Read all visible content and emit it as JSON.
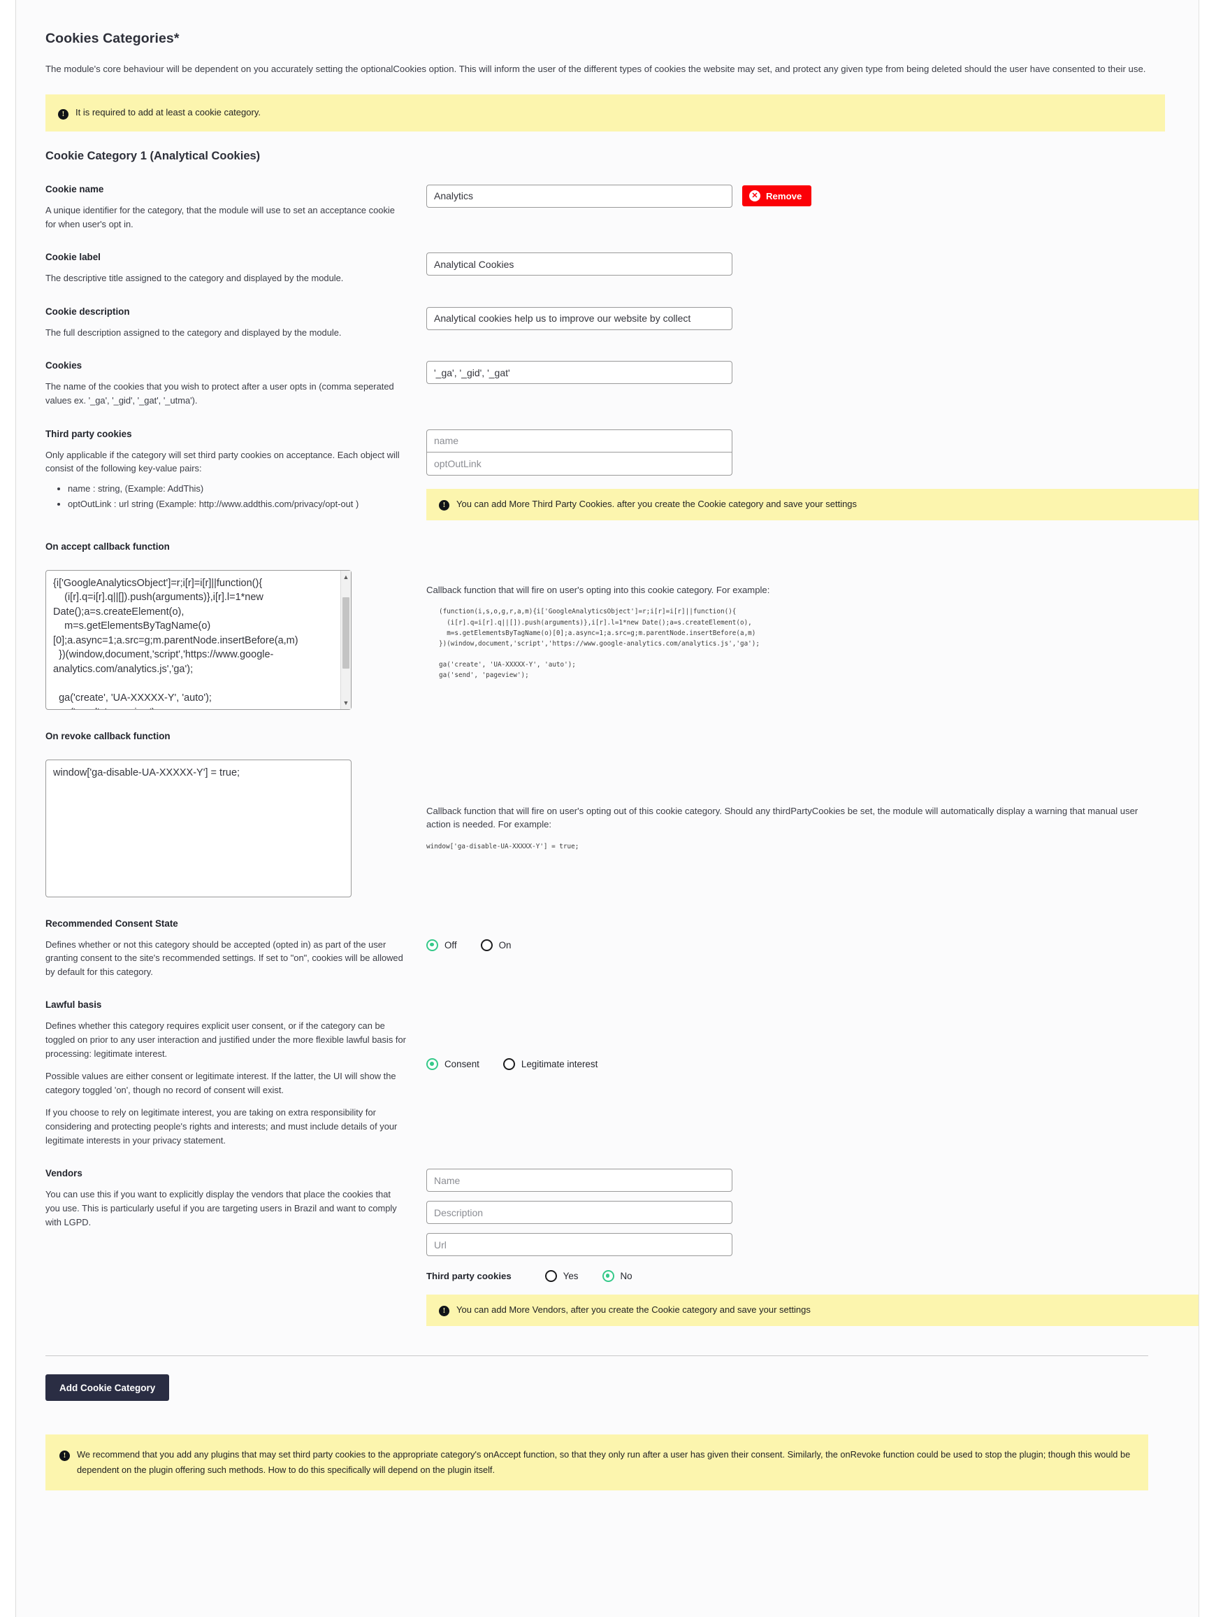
{
  "header": {
    "title": "Cookies Categories*",
    "description": "The module's core behaviour will be dependent on you accurately setting the optionalCookies option. This will inform the user of the different types of cookies the website may set, and protect any given type from being deleted should the user have consented to their use.",
    "notice": "It is required to add at least a cookie category.",
    "notice_icon": "exclamation-icon"
  },
  "category": {
    "title": "Cookie Category 1 (Analytical Cookies)",
    "cookie_name": {
      "label": "Cookie name",
      "description": "A unique identifier for the category, that the module will use to set an acceptance cookie for when user's opt in.",
      "value": "Analytics",
      "placeholder": "",
      "remove_label": "Remove",
      "remove_icon": "close-circle-icon"
    },
    "cookie_label": {
      "label": "Cookie label",
      "description": "The descriptive title assigned to the category and displayed by the module.",
      "value": "Analytical Cookies",
      "placeholder": ""
    },
    "cookie_description": {
      "label": "Cookie description",
      "description": "The full description assigned to the category and displayed by the module.",
      "value": "Analytical cookies help us to improve our website by collect",
      "placeholder": ""
    },
    "cookies": {
      "label": "Cookies",
      "description": "The name of the cookies that you wish to protect after a user opts in (comma seperated values ex. '_ga', '_gid', '_gat', '_utma').",
      "value": "'_ga', '_gid', '_gat'",
      "placeholder": ""
    },
    "third_party_cookies": {
      "label": "Third party cookies",
      "description": "Only applicable if the category will set third party cookies on acceptance. Each object will consist of the following key-value pairs:",
      "bullets": [
        "name : string, (Example: AddThis)",
        "optOutLink : url string (Example: http://www.addthis.com/privacy/opt-out )"
      ],
      "name_placeholder": "name",
      "optoutlink_placeholder": "optOutLink",
      "notice": "You can add More Third Party Cookies. after you create the Cookie category and save your settings"
    },
    "on_accept": {
      "label": "On accept callback function",
      "value": "{i['GoogleAnalyticsObject']=r;i[r]=i[r]||function(){\n    (i[r].q=i[r].q||[]).push(arguments)},i[r].l=1*new Date();a=s.createElement(o),\n    m=s.getElementsByTagName(o)[0];a.async=1;a.src=g;m.parentNode.insertBefore(a,m)\n  })(window,document,'script','https://www.google-analytics.com/analytics.js','ga');\n\n  ga('create', 'UA-XXXXX-Y', 'auto');\n  ga('send', 'pageview');",
      "help_text": "Callback function that will fire on user's opting into this cookie category. For example:",
      "help_code": "(function(i,s,o,g,r,a,m){i['GoogleAnalyticsObject']=r;i[r]=i[r]||function(){\n  (i[r].q=i[r].q||[]).push(arguments)},i[r].l=1*new Date();a=s.createElement(o),\n  m=s.getElementsByTagName(o)[0];a.async=1;a.src=g;m.parentNode.insertBefore(a,m)\n})(window,document,'script','https://www.google-analytics.com/analytics.js','ga');\n\nga('create', 'UA-XXXXX-Y', 'auto');\nga('send', 'pageview');"
    },
    "on_revoke": {
      "label": "On revoke callback function",
      "value": "window['ga-disable-UA-XXXXX-Y'] = true;",
      "help_text": "Callback function that will fire on user's opting out of this cookie category. Should any thirdPartyCookies be set, the module will automatically display a warning that manual user action is needed. For example:",
      "help_code": "window['ga-disable-UA-XXXXX-Y'] = true;"
    },
    "recommended_consent_state": {
      "label": "Recommended Consent State",
      "description": "Defines whether or not this category should be accepted (opted in) as part of the user granting consent to the site's recommended settings. If set to \"on\", cookies will be allowed by default for this category.",
      "options": [
        "Off",
        "On"
      ],
      "selected": "Off"
    },
    "lawful_basis": {
      "label": "Lawful basis",
      "paragraphs": [
        "Defines whether this category requires explicit user consent, or if the category can be toggled on prior to any user interaction and justified under the more flexible lawful basis for processing: legitimate interest.",
        "Possible values are either consent or legitimate interest. If the latter, the UI will show the category toggled 'on', though no record of consent will exist.",
        "If you choose to rely on legitimate interest, you are taking on extra responsibility for considering and protecting people's rights and interests; and must include details of your legitimate interests in your privacy statement."
      ],
      "options": [
        "Consent",
        "Legitimate interest"
      ],
      "selected": "Consent"
    },
    "vendors": {
      "label": "Vendors",
      "description": "You can use this if you want to explicitly display the vendors that place the cookies that you use. This is particularly useful if you are targeting users in Brazil and want to comply with LGPD.",
      "name_placeholder": "Name",
      "description_placeholder": "Description",
      "url_placeholder": "Url",
      "third_party_legend": "Third party cookies",
      "third_party_options": [
        "Yes",
        "No"
      ],
      "third_party_selected": "No",
      "notice": "You can add More Vendors, after you create the Cookie category and save your settings"
    }
  },
  "footer": {
    "add_button": "Add Cookie Category",
    "notice": "We recommend that you add any plugins that may set third party cookies to the appropriate category's onAccept function, so that they only run after a user has given their consent. Similarly, the onRevoke function could be used to stop the plugin; though this would be dependent on the plugin offering such methods. How to do this specifically will depend on the plugin itself."
  },
  "colors": {
    "notice_bg": "#fcf5ae",
    "remove_red": "#fb0007",
    "radio_green": "#36c98a",
    "add_button_bg": "#2a2d43"
  }
}
